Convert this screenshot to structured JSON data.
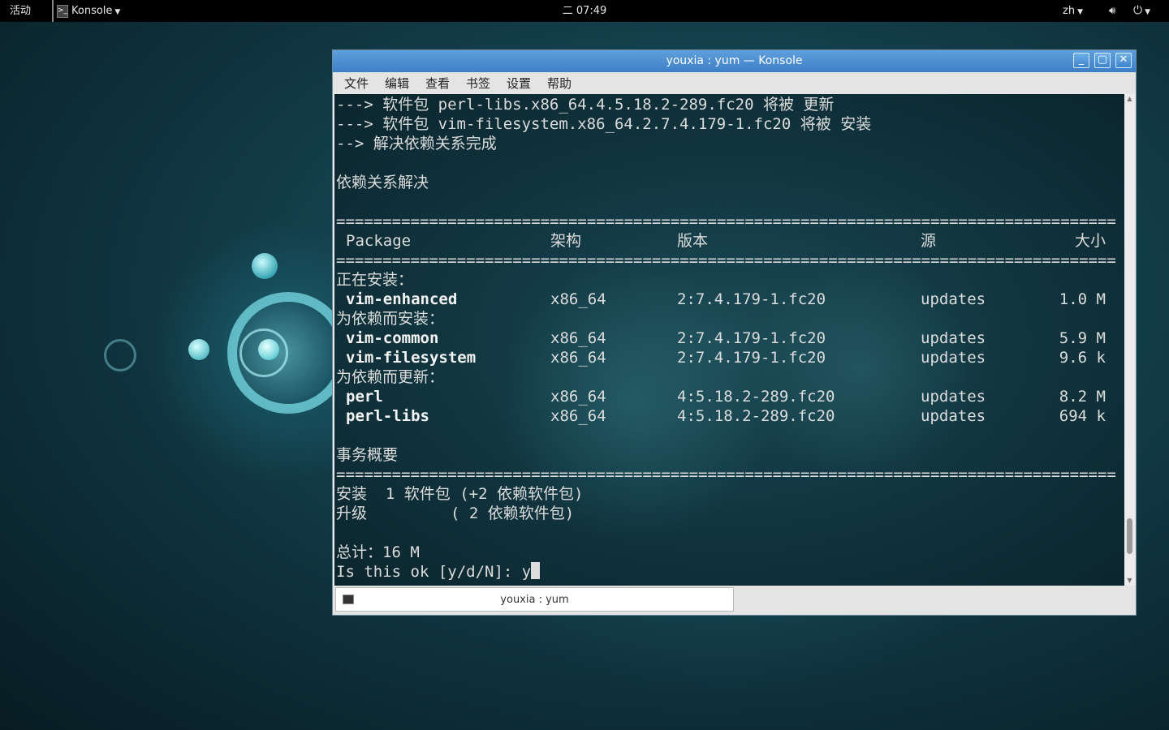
{
  "topbar": {
    "activities": "活动",
    "app_name": "Konsole",
    "clock": "二 07:49",
    "lang": "zh"
  },
  "window": {
    "title": "youxia : yum — Konsole",
    "menus": [
      "文件",
      "编辑",
      "查看",
      "书签",
      "设置",
      "帮助"
    ]
  },
  "terminal": {
    "line1": "---> 软件包 perl-libs.x86_64.4.5.18.2-289.fc20 将被 更新",
    "line2": "---> 软件包 vim-filesystem.x86_64.2.7.4.179-1.fc20 将被 安装",
    "line3": "--> 解决依赖关系完成",
    "deps_resolved": "依赖关系解决",
    "separator": "================================================================================================================================",
    "headers": {
      "package": "Package",
      "arch": "架构",
      "version": "版本",
      "repo": "源",
      "size": "大小"
    },
    "section_installing": "正在安装：",
    "section_dep_install": "为依赖而安装：",
    "section_dep_update": "为依赖而更新：",
    "packages": [
      {
        "name": "vim-enhanced",
        "arch": "x86_64",
        "version": "2:7.4.179-1.fc20",
        "repo": "updates",
        "size": "1.0 M"
      },
      {
        "name": "vim-common",
        "arch": "x86_64",
        "version": "2:7.4.179-1.fc20",
        "repo": "updates",
        "size": "5.9 M"
      },
      {
        "name": "vim-filesystem",
        "arch": "x86_64",
        "version": "2:7.4.179-1.fc20",
        "repo": "updates",
        "size": "9.6 k"
      },
      {
        "name": "perl",
        "arch": "x86_64",
        "version": "4:5.18.2-289.fc20",
        "repo": "updates",
        "size": "8.2 M"
      },
      {
        "name": "perl-libs",
        "arch": "x86_64",
        "version": "4:5.18.2-289.fc20",
        "repo": "updates",
        "size": "694 k"
      }
    ],
    "summary_title": "事务概要",
    "summary_install": "安装  1 软件包 (+2 依赖软件包)",
    "summary_upgrade": "升级         ( 2 依赖软件包)",
    "total": "总计：16 M",
    "prompt": "Is this ok [y/d/N]: y"
  },
  "tabs": [
    {
      "label": "youxia : yum"
    }
  ],
  "scrollbar": {
    "position": 0.95
  }
}
